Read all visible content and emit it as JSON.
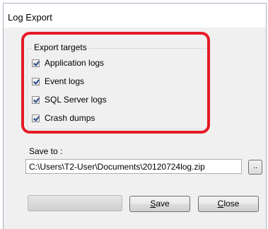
{
  "window": {
    "title": "Log Export"
  },
  "export_targets": {
    "legend": "Export targets",
    "items": [
      {
        "label": "Application logs",
        "checked": true
      },
      {
        "label": "Event logs",
        "checked": true
      },
      {
        "label": "SQL Server logs",
        "checked": true
      },
      {
        "label": "Crash dumps",
        "checked": true
      }
    ]
  },
  "save_to": {
    "label": "Save to :",
    "value": "C:\\Users\\T2-User\\Documents\\20120724log.zip",
    "browse_label": ".."
  },
  "buttons": {
    "save_mnemonic": "S",
    "save_rest": "ave",
    "close_mnemonic": "C",
    "close_rest": "lose"
  },
  "progress": {
    "value": 0
  },
  "colors": {
    "highlight": "#e51a26",
    "window_bg": "#f0f0f0"
  }
}
